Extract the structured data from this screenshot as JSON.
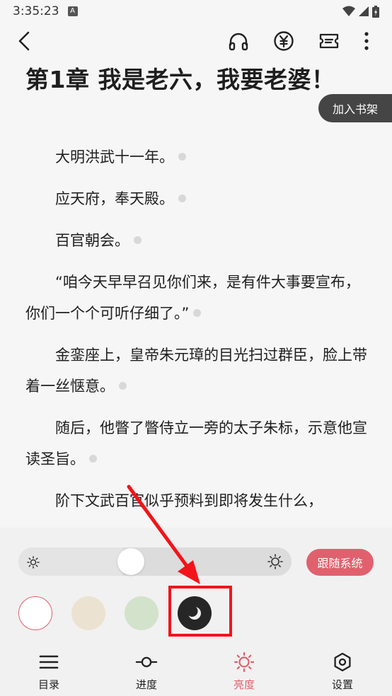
{
  "status_bar": {
    "time": "3:35:23",
    "notification_badge": "A"
  },
  "chapter": {
    "title": "第1章 我是老六，我要老婆！",
    "add_shelf_label": "加入书架",
    "paragraphs": [
      "大明洪武十一年。",
      "应天府，奉天殿。",
      "百官朝会。",
      "“咱今天早早召见你们来，是有件大事要宣布，你们一个个可听仔细了。”",
      "金銮座上，皇帝朱元璋的目光扫过群臣，脸上带着一丝惬意。",
      "随后，他瞥了瞥侍立一旁的太子朱标，示意他宣读圣旨。",
      "阶下文武百官似乎预料到即将发生什么，"
    ]
  },
  "brightness": {
    "level": 0.38,
    "follow_system_label": "跟随系统"
  },
  "themes": [
    {
      "name": "white",
      "color": "#ffffff",
      "selected": true
    },
    {
      "name": "beige",
      "color": "#ece2d2",
      "selected": false
    },
    {
      "name": "green",
      "color": "#d3e2cb",
      "selected": false
    },
    {
      "name": "night",
      "color": "#262626",
      "selected": false,
      "icon": "moon-icon"
    }
  ],
  "colors": {
    "accent": "#e0616d",
    "annotation": "#f2141a"
  },
  "bottom_nav": [
    {
      "label": "目录",
      "icon": "list-icon",
      "active": false
    },
    {
      "label": "进度",
      "icon": "progress-icon",
      "active": false
    },
    {
      "label": "亮度",
      "icon": "brightness-icon",
      "active": true
    },
    {
      "label": "设置",
      "icon": "settings-icon",
      "active": false
    }
  ]
}
